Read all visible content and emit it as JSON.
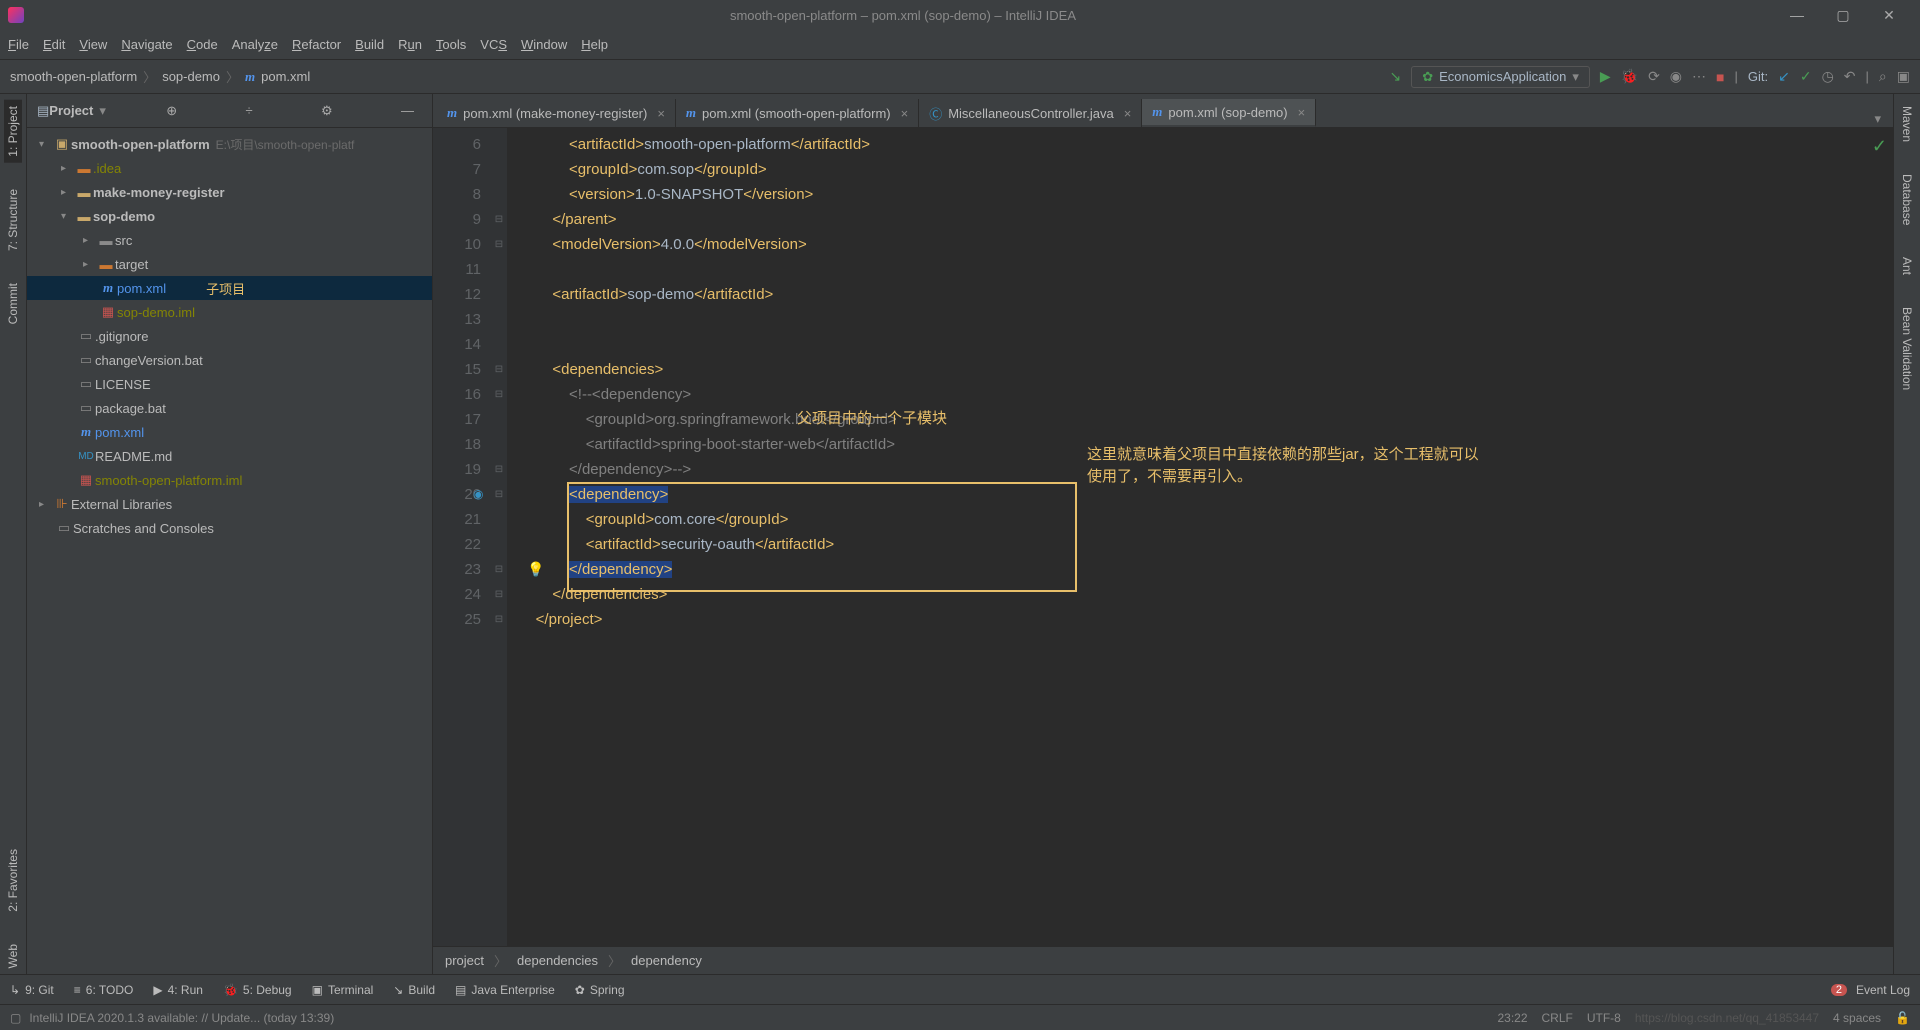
{
  "window": {
    "title": "smooth-open-platform – pom.xml (sop-demo) – IntelliJ IDEA"
  },
  "menu": [
    "File",
    "Edit",
    "View",
    "Navigate",
    "Code",
    "Analyze",
    "Refactor",
    "Build",
    "Run",
    "Tools",
    "VCS",
    "Window",
    "Help"
  ],
  "breadcrumbs": {
    "a": "smooth-open-platform",
    "b": "sop-demo",
    "c": "pom.xml"
  },
  "runConfig": "EconomicsApplication",
  "gitLabel": "Git:",
  "project": {
    "header": "Project",
    "root": {
      "name": "smooth-open-platform",
      "path": "E:\\项目\\smooth-open-platf"
    },
    "items": {
      "idea": ".idea",
      "mmr": "make-money-register",
      "sop": "sop-demo",
      "src": "src",
      "target": "target",
      "pom": "pom.xml",
      "iml": "sop-demo.iml",
      "git": ".gitignore",
      "cvbat": "changeVersion.bat",
      "lic": "LICENSE",
      "pkbat": "package.bat",
      "pom2": "pom.xml",
      "readme": "README.md",
      "rootiml": "smooth-open-platform.iml",
      "extlib": "External Libraries",
      "scratch": "Scratches and Consoles"
    },
    "subAnnot": "子项目"
  },
  "tabs": [
    {
      "label": "pom.xml (make-money-register)",
      "icon": "m",
      "active": false
    },
    {
      "label": "pom.xml (smooth-open-platform)",
      "icon": "m",
      "active": false
    },
    {
      "label": "MiscellaneousController.java",
      "icon": "c",
      "active": false
    },
    {
      "label": "pom.xml (sop-demo)",
      "icon": "m",
      "active": true
    }
  ],
  "code": {
    "startLine": 6,
    "lines": [
      {
        "n": 6,
        "ind": 3,
        "html": "<span class='tag'>&lt;artifactId&gt;</span><span class='txt'>smooth-open-platform</span><span class='tag'>&lt;/artifactId&gt;</span>"
      },
      {
        "n": 7,
        "ind": 3,
        "html": "<span class='tag'>&lt;groupId&gt;</span><span class='txt'>com.sop</span><span class='tag'>&lt;/groupId&gt;</span>"
      },
      {
        "n": 8,
        "ind": 3,
        "html": "<span class='tag'>&lt;version&gt;</span><span class='txt'>1.0-SNAPSHOT</span><span class='tag'>&lt;/version&gt;</span>"
      },
      {
        "n": 9,
        "ind": 2,
        "html": "<span class='tag'>&lt;/parent&gt;</span>"
      },
      {
        "n": 10,
        "ind": 2,
        "html": "<span class='tag'>&lt;modelVersion&gt;</span><span class='txt'>4.0.0</span><span class='tag'>&lt;/modelVersion&gt;</span>"
      },
      {
        "n": 11,
        "ind": 2,
        "html": ""
      },
      {
        "n": 12,
        "ind": 2,
        "html": "<span class='tag'>&lt;artifactId&gt;</span><span class='txt'>sop-demo</span><span class='tag'>&lt;/artifactId&gt;</span>"
      },
      {
        "n": 13,
        "ind": 2,
        "html": ""
      },
      {
        "n": 14,
        "ind": 2,
        "html": ""
      },
      {
        "n": 15,
        "ind": 2,
        "html": "<span class='tag'>&lt;dependencies&gt;</span>"
      },
      {
        "n": 16,
        "ind": 3,
        "html": "<span class='cmt'>&lt;!--&lt;dependency&gt;</span>"
      },
      {
        "n": 17,
        "ind": 4,
        "html": "<span class='cmt'>&lt;groupId&gt;org.springframework.boot&lt;/groupId&gt;</span>"
      },
      {
        "n": 18,
        "ind": 4,
        "html": "<span class='cmt'>&lt;artifactId&gt;spring-boot-starter-web&lt;/artifactId&gt;</span>"
      },
      {
        "n": 19,
        "ind": 3,
        "html": "<span class='cmt'>&lt;/dependency&gt;--&gt;</span>"
      },
      {
        "n": 20,
        "ind": 3,
        "html": "<span class='tag hl'>&lt;dependency&gt;</span>"
      },
      {
        "n": 21,
        "ind": 4,
        "html": "<span class='tag'>&lt;groupId&gt;</span><span class='txt'>com.core</span><span class='tag'>&lt;/groupId&gt;</span>"
      },
      {
        "n": 22,
        "ind": 4,
        "html": "<span class='tag'>&lt;artifactId&gt;</span><span class='txt'>security-oauth</span><span class='tag'>&lt;/artifactId&gt;</span>"
      },
      {
        "n": 23,
        "ind": 3,
        "html": "<span class='tag hl'>&lt;/dependency&gt;</span>"
      },
      {
        "n": 24,
        "ind": 2,
        "html": "<span class='tag'>&lt;/dependencies&gt;</span>"
      },
      {
        "n": 25,
        "ind": 1,
        "html": "<span class='tag'>&lt;/project&gt;</span>"
      }
    ]
  },
  "annotations": {
    "a1": "父项目中的一个子模块",
    "a2": "这里就意味着父项目中直接依赖的那些jar，这个工程就可以使用了，不需要再引入。"
  },
  "breadcrumbBot": [
    "project",
    "dependencies",
    "dependency"
  ],
  "bottomTabs": {
    "git": "9: Git",
    "todo": "6: TODO",
    "run": "4: Run",
    "debug": "5: Debug",
    "terminal": "Terminal",
    "build": "Build",
    "je": "Java Enterprise",
    "spring": "Spring",
    "eventlog": "Event Log"
  },
  "eventBadge": "2",
  "status": {
    "msg": "IntelliJ IDEA 2020.1.3 available: // Update... (today 13:39)",
    "time": "23:22",
    "eol": "CRLF",
    "enc": "UTF-8",
    "indent": "4 spaces",
    "watermark": "https://blog.csdn.net/qq_41853447"
  },
  "leftTabs": [
    "1: Project",
    "7: Structure",
    "Commit",
    "2: Favorites",
    "Web"
  ],
  "rightTabs": [
    "Maven",
    "Database",
    "Ant",
    "Bean Validation"
  ]
}
